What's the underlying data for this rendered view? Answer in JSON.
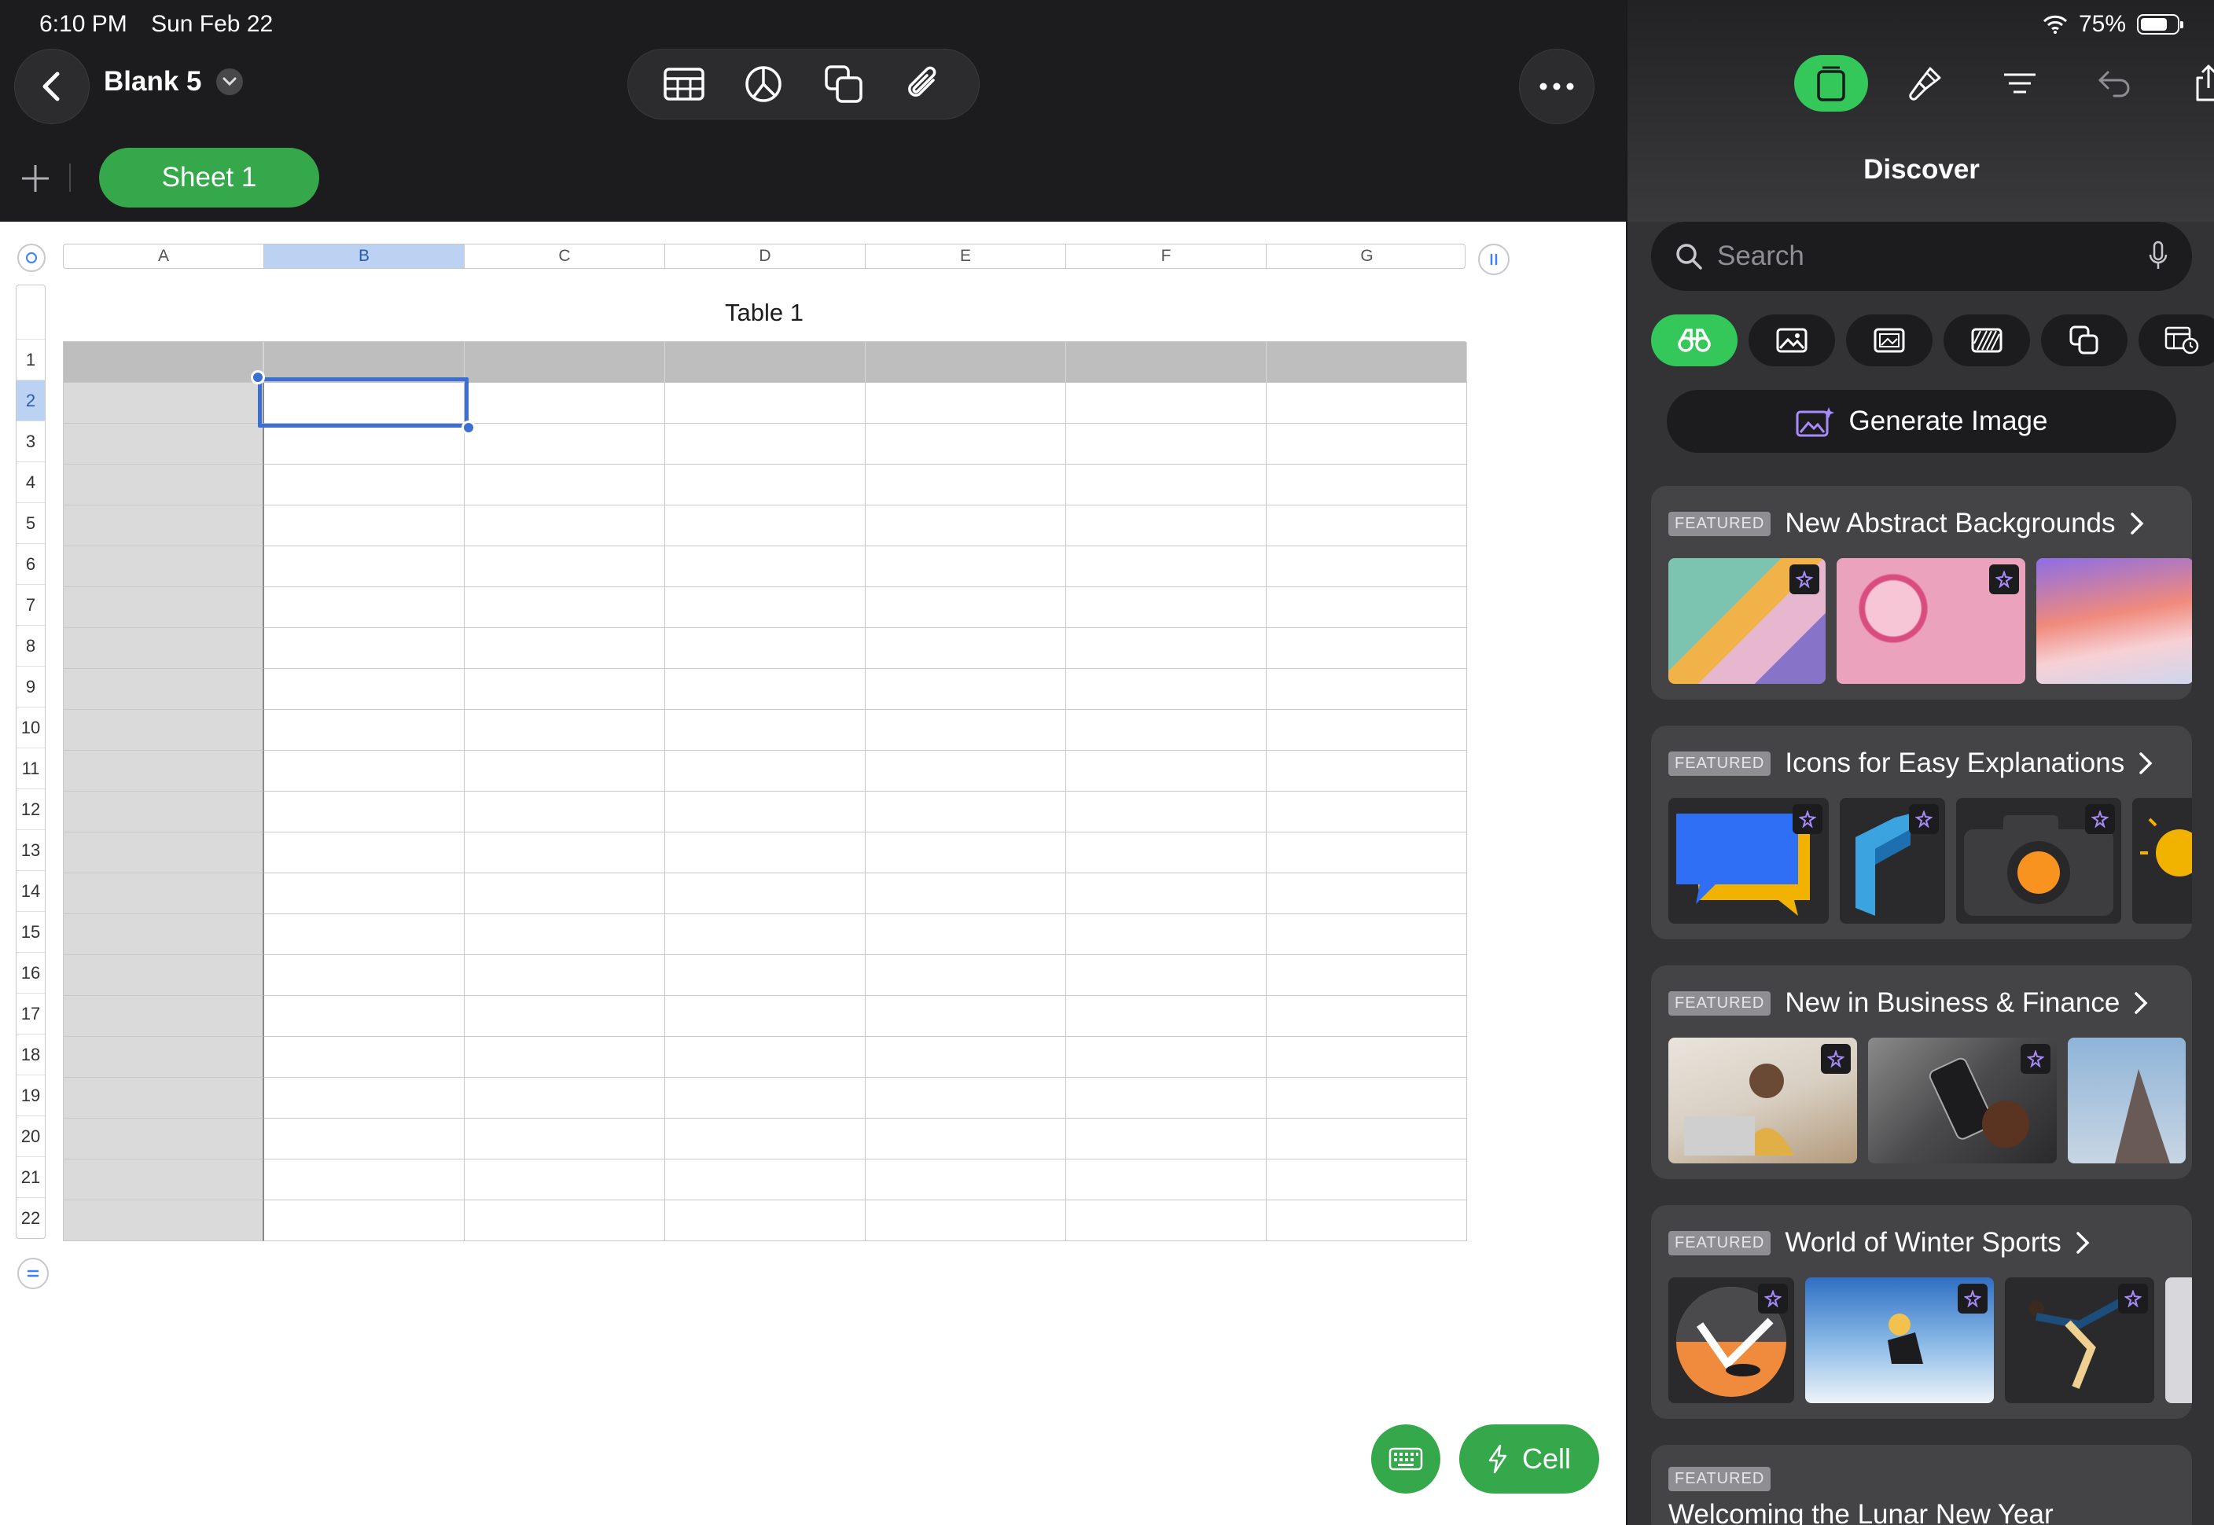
{
  "status": {
    "time": "6:10 PM",
    "date": "Sun Feb 22",
    "battery": "75%"
  },
  "document": {
    "title": "Blank 5"
  },
  "sheets": [
    {
      "label": "Sheet 1"
    }
  ],
  "table": {
    "title": "Table 1",
    "columns": [
      "A",
      "B",
      "C",
      "D",
      "E",
      "F",
      "G"
    ],
    "rows": [
      "1",
      "2",
      "3",
      "4",
      "5",
      "6",
      "7",
      "8",
      "9",
      "10",
      "11",
      "12",
      "13",
      "14",
      "15",
      "16",
      "17",
      "18",
      "19",
      "20",
      "21",
      "22"
    ],
    "selected_column": "B",
    "selected_row": "2"
  },
  "fab": {
    "cell_label": "Cell"
  },
  "panel": {
    "title": "Discover",
    "search_placeholder": "Search",
    "generate_label": "Generate Image",
    "cards": [
      {
        "badge": "FEATURED",
        "title": "New Abstract Backgrounds"
      },
      {
        "badge": "FEATURED",
        "title": "Icons for Easy Explanations"
      },
      {
        "badge": "FEATURED",
        "title": "New in Business & Finance"
      },
      {
        "badge": "FEATURED",
        "title": "World of Winter Sports"
      },
      {
        "badge": "FEATURED",
        "title": "Welcoming the Lunar New Year"
      }
    ]
  },
  "colors": {
    "accent_green": "#34c759",
    "sheet_green": "#34a84a",
    "selection_blue": "#3b6fd1",
    "toolbar_dark": "#1c1c1e"
  },
  "icons": {
    "toolbar": [
      "table-icon",
      "chart-icon",
      "shapes-icon",
      "paperclip-icon"
    ],
    "panel_top": [
      "media-browser-icon",
      "format-brush-icon",
      "organize-icon",
      "undo-icon",
      "share-icon"
    ],
    "categories": [
      "binoculars-icon",
      "photo-icon",
      "photo-frame-icon",
      "pattern-icon",
      "shapes-icon",
      "table-clock-icon"
    ]
  }
}
